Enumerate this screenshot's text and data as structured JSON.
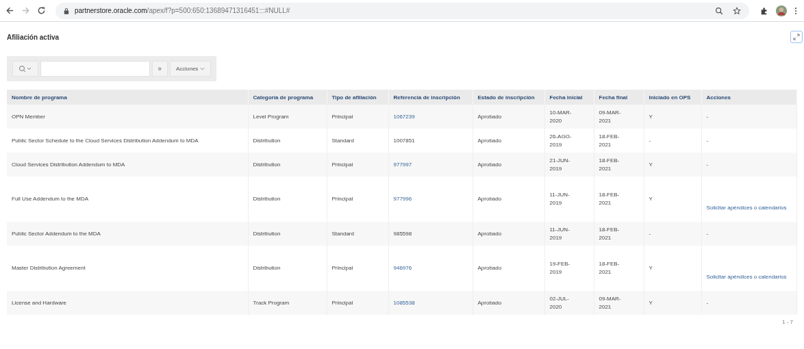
{
  "browser": {
    "url_host": "partnerstore.oracle.com",
    "url_path": "/apex/f?p=500:650:13689471316451:::#NULL#"
  },
  "page": {
    "title": "Afiliación activa"
  },
  "toolbar": {
    "go_button": "Ir",
    "actions_button": "Acciones"
  },
  "table": {
    "columns": [
      "Nombre de programa",
      "Categoría de programa",
      "Tipo de afiliación",
      "Referencia de inscripción",
      "Estado de inscripción",
      "Fecha inicial",
      "Fecha final",
      "Iniciado en OPS",
      "Acciones"
    ],
    "rows": [
      {
        "name": "OPN Member",
        "category": "Level Program",
        "type": "Principal",
        "reference": "1067239",
        "reference_link": true,
        "status": "Aprobado",
        "start": "10-MAR-2020",
        "end": "09-MAR-2021",
        "ops": "Y",
        "action": "-",
        "action_link": false
      },
      {
        "name": "Public Sector Schedule to the Cloud Services Distribution Addendum to MDA",
        "category": "Distribution",
        "type": "Standard",
        "reference": "1007851",
        "reference_link": false,
        "status": "Aprobado",
        "start": "26-AGO-2019",
        "end": "18-FEB-2021",
        "ops": "-",
        "action": "-",
        "action_link": false
      },
      {
        "name": "Cloud Services Distribution Addendum to MDA",
        "category": "Distribution",
        "type": "Principal",
        "reference": "977997",
        "reference_link": true,
        "status": "Aprobado",
        "start": "21-JUN-2019",
        "end": "18-FEB-2021",
        "ops": "Y",
        "action": "-",
        "action_link": false
      },
      {
        "name": "Full Use Addendum to the MDA",
        "category": "Distribution",
        "type": "Principal",
        "reference": "977996",
        "reference_link": true,
        "status": "Aprobado",
        "start": "11-JUN-2019",
        "end": "18-FEB-2021",
        "ops": "Y",
        "action": "Solicitar apéndices o calendarios",
        "action_link": true
      },
      {
        "name": "Public Sector Addendum to the MDA",
        "category": "Distribution",
        "type": "Standard",
        "reference": "985598",
        "reference_link": false,
        "status": "Aprobado",
        "start": "11-JUN-2019",
        "end": "18-FEB-2021",
        "ops": "-",
        "action": "-",
        "action_link": false
      },
      {
        "name": "Master Distribution Agreement",
        "category": "Distribution",
        "type": "Principal",
        "reference": "946976",
        "reference_link": true,
        "status": "Aprobado",
        "start": "19-FEB-2019",
        "end": "18-FEB-2021",
        "ops": "Y",
        "action": "Solicitar apéndices o calendarios",
        "action_link": true
      },
      {
        "name": "License and Hardware",
        "category": "Track Program",
        "type": "Principal",
        "reference": "1085538",
        "reference_link": true,
        "status": "Aprobado",
        "start": "02-JUL-2020",
        "end": "09-MAR-2021",
        "ops": "Y",
        "action": "-",
        "action_link": false
      }
    ]
  },
  "pagination": "1 - 7"
}
